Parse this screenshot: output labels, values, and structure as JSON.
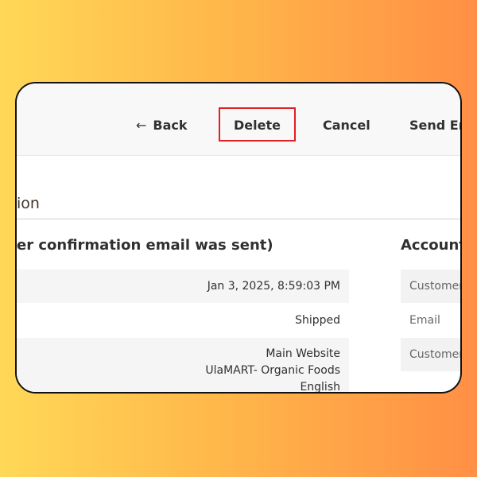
{
  "toolbar": {
    "back_icon": "←",
    "back_label": "Back",
    "delete_label": "Delete",
    "cancel_label": "Cancel",
    "send_label": "Send Er"
  },
  "section": {
    "title": "ion",
    "subtitle": "er confirmation email was sent)"
  },
  "order_info": {
    "date": "Jan 3, 2025, 8:59:03 PM",
    "status": "Shipped",
    "store_line1": "Main Website",
    "store_line2": "UlaMART- Organic Foods",
    "store_line3": "English"
  },
  "account": {
    "title": "Account",
    "rows": [
      "Customer",
      "Email",
      "Customer"
    ]
  },
  "colors": {
    "highlight": "#e02020",
    "background_gradient_start": "#ffd857",
    "background_gradient_end": "#ff8f45"
  }
}
